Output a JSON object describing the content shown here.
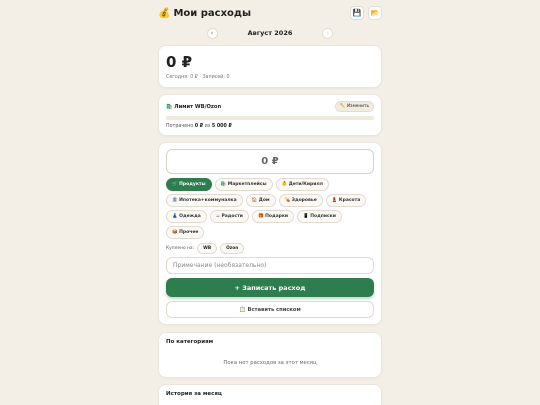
{
  "app": {
    "title": "Мои расходы",
    "title_emoji": "💰",
    "save_icon": "💾",
    "folder_icon": "📂"
  },
  "month": {
    "label": "Август 2026",
    "prev": "‹",
    "next": "›"
  },
  "total": {
    "amount": "0 ₽",
    "summary": "Сегодня: 0 ₽ · Записей: 0"
  },
  "limit": {
    "title": "🛍️ Лимит WB/Ozon",
    "edit_label": "✏️ Изменить",
    "spent_prefix": "Потрачено",
    "spent_value": "0 ₽",
    "spent_of": "из",
    "limit_value": "5 000 ₽",
    "fill_fraction": 0
  },
  "entry": {
    "amount_placeholder": "0 ₽",
    "categories": [
      {
        "label": "🛒 Продукты",
        "active": true
      },
      {
        "label": "🛍️ Маркетплейсы",
        "active": false
      },
      {
        "label": "👶 Дети/Кирилл",
        "active": false
      },
      {
        "label": "🏦 Ипотека+коммуналка",
        "active": false
      },
      {
        "label": "🏠 Дом",
        "active": false
      },
      {
        "label": "💊 Здоровье",
        "active": false
      },
      {
        "label": "💄 Красота",
        "active": false
      },
      {
        "label": "👗 Одежда",
        "active": false
      },
      {
        "label": "☕ Радости",
        "active": false
      },
      {
        "label": "🎁 Подарки",
        "active": false
      },
      {
        "label": "📱 Подписки",
        "active": false
      },
      {
        "label": "📦 Прочее",
        "active": false
      }
    ],
    "bought_label": "Куплено на:",
    "bought_options": [
      "WB",
      "Ozon"
    ],
    "note_placeholder": "Примечание (необязательно)",
    "submit_label": "+ Записать расход",
    "paste_label": "📋 Вставить списком"
  },
  "by_category": {
    "title": "По категориям",
    "empty": "Пока нет расходов за этот месяц"
  },
  "history": {
    "title": "История за месяц"
  },
  "colors": {
    "accent": "#2e7d4f",
    "background": "#f4efe6"
  }
}
